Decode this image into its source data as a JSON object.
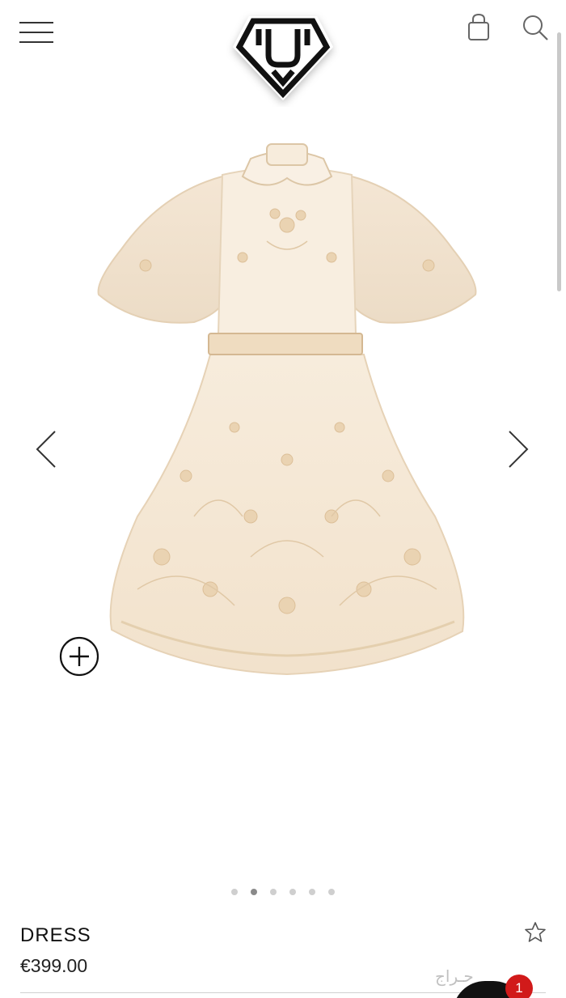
{
  "header": {
    "menu_icon": "hamburger-menu-icon",
    "logo_icon": "brand-diamond-logo",
    "bag_icon": "shopping-bag-icon",
    "search_icon": "search-icon"
  },
  "gallery": {
    "prev_icon": "chevron-left-icon",
    "next_icon": "chevron-right-icon",
    "zoom_icon": "plus-circle-icon",
    "dot_count": 6,
    "active_dot": 1
  },
  "product": {
    "name": "DRESS",
    "price": "€399.00",
    "favorite_icon": "star-outline-icon"
  },
  "overlay": {
    "watermark": "حـراج",
    "cart_count": "1"
  },
  "colors": {
    "dress": "#f6ead8",
    "badge": "#d11a1a",
    "logo": "#111111"
  }
}
